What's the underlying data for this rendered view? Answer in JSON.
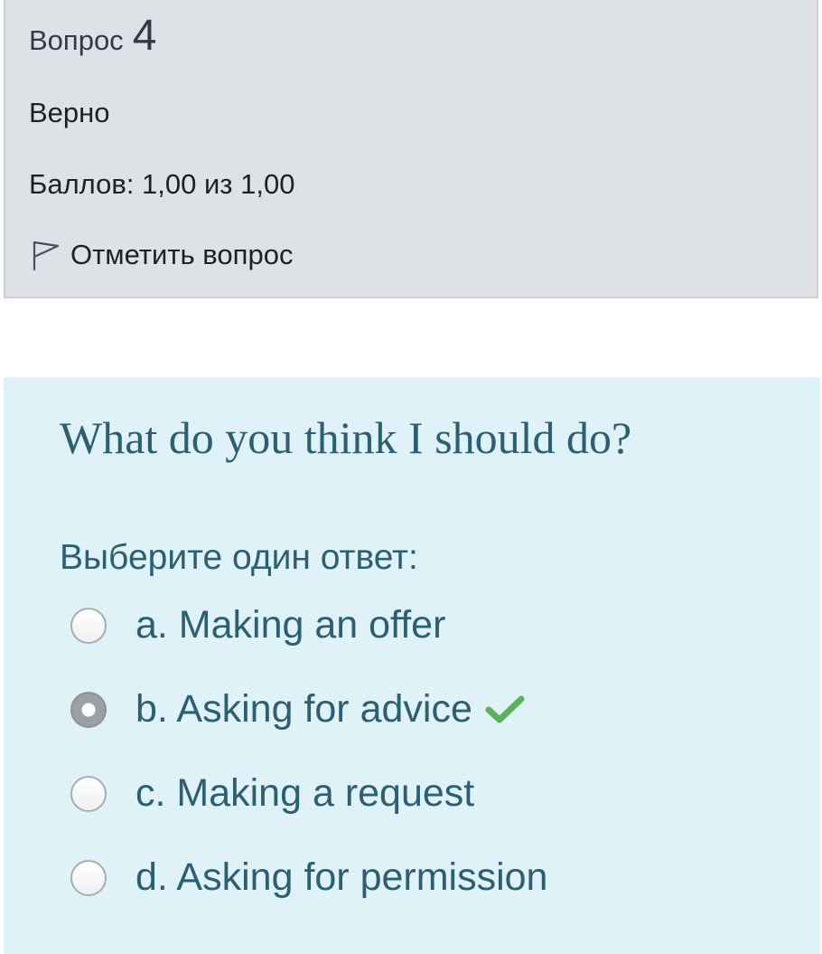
{
  "info": {
    "question_word": "Вопрос",
    "question_number": "4",
    "state": "Верно",
    "grade": "Баллов: 1,00 из 1,00",
    "flag_label": "Отметить вопрос"
  },
  "question": {
    "text": "What do you think I should do?",
    "prompt": "Выберите один ответ:",
    "answers": [
      {
        "label": "a. Making an offer",
        "selected": false,
        "correct": false
      },
      {
        "label": "b. Asking for advice",
        "selected": true,
        "correct": true
      },
      {
        "label": "c. Making a request",
        "selected": false,
        "correct": false
      },
      {
        "label": "d. Asking for permission",
        "selected": false,
        "correct": false
      }
    ]
  },
  "icons": {
    "flag": "flag-icon",
    "correct": "check-icon"
  },
  "colors": {
    "info_bg": "#dee2e6",
    "content_bg": "#def2f8",
    "text_teal": "#2b5f71",
    "correct_green": "#5bb15a"
  }
}
